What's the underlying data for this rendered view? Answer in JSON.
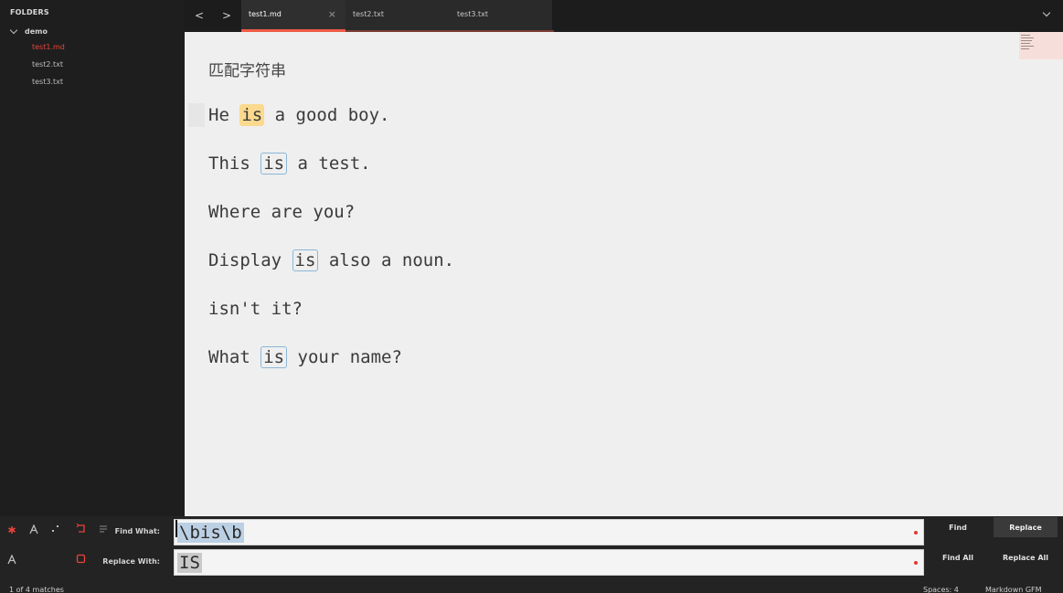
{
  "sidebar": {
    "header": "FOLDERS",
    "folder": "demo",
    "files": [
      "test1.md",
      "test2.txt",
      "test3.txt"
    ],
    "active_file": "test1.md"
  },
  "tabbar": {
    "tabs": [
      {
        "label": "test1.md",
        "active": true
      },
      {
        "label": "test2.txt",
        "active": false
      },
      {
        "label": "test3.txt",
        "active": false
      }
    ],
    "back_glyph": "<",
    "forward_glyph": ">",
    "close_glyph": "×"
  },
  "editor": {
    "heading": "匹配字符串",
    "lines": [
      {
        "pre": "He ",
        "match": "is",
        "post": " a good boy."
      },
      {
        "pre": "This ",
        "match": "is",
        "post": " a test."
      },
      {
        "text": "Where are you?"
      },
      {
        "pre": "Display ",
        "match": "is",
        "post": " also a noun."
      },
      {
        "text": "isn't it?"
      },
      {
        "pre": "What ",
        "match": "is",
        "post": " your name?"
      }
    ]
  },
  "find_panel": {
    "find_label": "Find What:",
    "replace_label": "Replace With:",
    "find_value": "\\bis\\b",
    "replace_value": "IS",
    "find_button": "Find",
    "replace_button": "Replace",
    "find_all_button": "Find All",
    "replace_all_button": "Replace All"
  },
  "status": {
    "matches": "1 of 4 matches",
    "spaces": "Spaces: 4",
    "syntax": "Markdown GFM"
  },
  "colors": {
    "accent": "#ef5b45",
    "current_match": "#fbd98e",
    "match_border": "#8bb6d8",
    "editor_bg": "#efefef"
  }
}
